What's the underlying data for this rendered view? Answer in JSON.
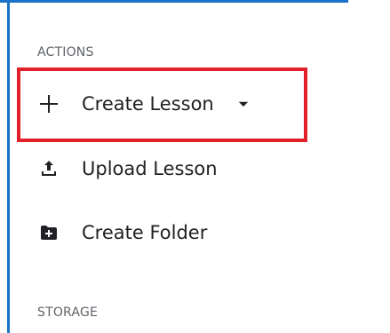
{
  "sidebar": {
    "sections": {
      "actions_label": "ACTIONS",
      "storage_label": "STORAGE"
    },
    "items": [
      {
        "label": "Create Lesson",
        "icon": "plus-icon",
        "has_dropdown": true
      },
      {
        "label": "Upload Lesson",
        "icon": "upload-icon"
      },
      {
        "label": "Create Folder",
        "icon": "folder-add-icon"
      }
    ]
  },
  "colors": {
    "highlight": "#e2202b",
    "frame": "#1a73c8",
    "text": "#202124",
    "muted": "#5f6368"
  }
}
